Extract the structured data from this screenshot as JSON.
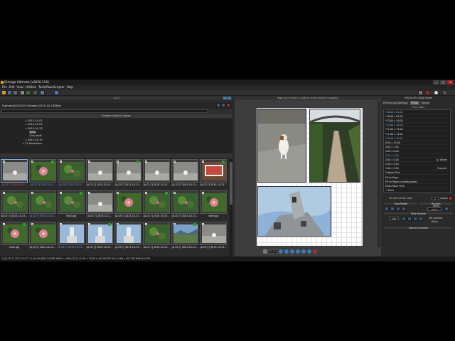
{
  "window": {
    "title": "Qimage Ultimate [v2020.110]",
    "minimize": "_",
    "maximize": "□",
    "close": "✕"
  },
  "menu": [
    "File",
    "Edit",
    "View",
    "Utilities",
    "Tools/Raw/Scripter",
    "Help"
  ],
  "left": {
    "counter": "1/13",
    "path": "f:\\photos\\2015\\10 October 2015-10-13\\Raw",
    "folders_header": "Folders (click to close)",
    "tree": [
      {
        "label": "2015-10-02",
        "indent": 2,
        "arrow": "▸"
      },
      {
        "label": "2015-10-07",
        "indent": 2,
        "arrow": "▸"
      },
      {
        "label": "2015-10-13",
        "indent": 2,
        "arrow": "▾"
      },
      {
        "label": "Raw",
        "indent": 3,
        "arrow": "",
        "selected": true
      },
      {
        "label": "3 bs-matt",
        "indent": 3,
        "arrow": ""
      },
      {
        "label": "2015-10-15",
        "indent": 2,
        "arrow": "▸"
      },
      {
        "label": "11 November",
        "indent": 1,
        "arrow": "▸"
      }
    ],
    "thumbnails": [
      {
        "label": "[A,CE,7] 2015-10-1...",
        "color": "red",
        "img": "gray"
      },
      {
        "label": "[A,CE,7] 2015-10-1...",
        "color": "blue",
        "img": "pink"
      },
      {
        "label": "[A,CE,7] 2015-10-1...",
        "color": "blue",
        "img": "green"
      },
      {
        "label": "[A,CE,7] 2015-10-13...",
        "color": "white",
        "img": "gray"
      },
      {
        "label": "[A,CE,7] 2015-10-13...",
        "color": "white",
        "img": "gray"
      },
      {
        "label": "[A,CE,7] 2015-10-13...",
        "color": "white",
        "img": "gray"
      },
      {
        "label": "[A,CE,7] 2015-10-13...",
        "color": "white",
        "img": "gray"
      },
      {
        "label": "[A,CE,7] 2015-10-13...",
        "color": "white",
        "img": "room"
      },
      {
        "label": "[A,CE,7] 2015-10-13...",
        "color": "white",
        "img": "green"
      },
      {
        "label": "[A,CE,7] 2015-10-13...",
        "color": "blue",
        "img": "green"
      },
      {
        "label": "line2.jpg",
        "color": "white",
        "img": "green"
      },
      {
        "label": "[A,CE,7] 2015-10-1...",
        "color": "white",
        "img": "gray"
      },
      {
        "label": "[A,CE,7] 2015-10-13...",
        "color": "white",
        "img": "pink"
      },
      {
        "label": "[A,CE,7] 2015-10-13...",
        "color": "white",
        "img": "green"
      },
      {
        "label": "[A,CE,7] 2015-10-13...",
        "color": "white",
        "img": "green"
      },
      {
        "label": "line3.jpg",
        "color": "white",
        "img": "pink"
      },
      {
        "label": "line2.jpg",
        "color": "white",
        "img": "pink"
      },
      {
        "label": "[A,CE,7] 2015-10-13...",
        "color": "white",
        "img": "pink"
      },
      {
        "label": "[A,CE,7] 2015-10-13...",
        "color": "blue",
        "img": "tower"
      },
      {
        "label": "[A,CE,7] 2015-10-13...",
        "color": "white",
        "img": "tower"
      },
      {
        "label": "[A,CE,7] 2015-10-13...",
        "color": "white",
        "img": "tower"
      },
      {
        "label": "[A,CE,7] 2015-10-13...",
        "color": "white",
        "img": "green"
      },
      {
        "label": "[A,CE,7] 2015-10-13...",
        "color": "white",
        "img": "landscape"
      },
      {
        "label": "[A,CE,7] 2015-10-13...",
        "color": "white",
        "img": "gray"
      }
    ]
  },
  "status": "C:\\[A,CE,7] 2015-10-13 11:00:16.ARW   24.0MP 6000 × 4000 [3:2]  13.40 × 20.00 in @ 300 PPI  f/8.0 1/60 s ISO 100  RAW  6.4 MB",
  "center": {
    "page_info": "Page 1/1: 8.500 x 11.000 in (0.26 x 0.00 in margins)",
    "page_box": "1 / 1"
  },
  "right": {
    "printer": "EPSON XP-15000 Series",
    "tabs": [
      "Printers and Settings",
      "Prints",
      "Queue"
    ],
    "sizes_header": "Print Sizes",
    "sizes": [
      {
        "label": "*16.00 x 24.00",
        "hl": true
      },
      {
        "label": "*16.00 x 20.00",
        "hl": false
      },
      {
        "label": "*13.00 x 19.00",
        "hl": false
      },
      {
        "label": "*12.00 x 18.00",
        "hl": true
      },
      {
        "label": "*11.00 x 17.00",
        "hl": false
      },
      {
        "label": "*11.00 x 14.00",
        "hl": false
      },
      {
        "label": "*10.00 x 15.00",
        "hl": true
      },
      {
        "label": "8.00 x 10.00",
        "hl": false
      },
      {
        "label": "5.00 x 7.00",
        "hl": false
      },
      {
        "label": "4.00 x 6.00",
        "hl": false
      },
      {
        "label": "3.50 x 5.00",
        "hl": true
      },
      {
        "label": "3.00 x 4.00",
        "hl": false,
        "sub": "Lg. Wallet"
      },
      {
        "label": "2.50 x 3.50",
        "hl": false
      },
      {
        "label": "2.00 x 2.00",
        "hl": false,
        "sub": "Passport"
      },
      {
        "label": "Original Size",
        "hl": false
      },
      {
        "label": "Fill to Page",
        "hl": false
      },
      {
        "label": "Fill to Paper (scaled/copies)",
        "hl": false
      },
      {
        "label": "Multi-Panel Print",
        "hl": false
      },
      {
        "label": "+ More",
        "hl": false
      }
    ],
    "add_label": "For new prints, add",
    "copies_value": "1",
    "copies_label": "copies",
    "crop_bar": "Crop/Rotate",
    "borders_bar": "Borders",
    "bw_label": "Width",
    "bw_value": "0.00",
    "fp_label": "Print Position",
    "zoom_value": "100",
    "set_position": "Set position",
    "move": "Move",
    "sp_label": "Specify selected"
  }
}
